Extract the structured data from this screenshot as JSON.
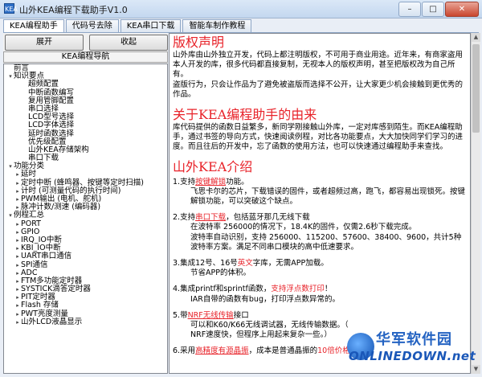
{
  "window": {
    "title": "山外KEA编程下载助手V1.0",
    "icon_text": "KEA",
    "minimize": "–",
    "maximize": "□",
    "close": "✕"
  },
  "tabs": [
    {
      "label": "KEA编程助手",
      "active": true
    },
    {
      "label": "代码号去除",
      "active": false
    },
    {
      "label": "KEA串口下载",
      "active": false
    },
    {
      "label": "智能车制作教程",
      "active": false
    }
  ],
  "left": {
    "expand_label": "展开",
    "collapse_label": "收起",
    "nav_title": "KEA编程导航",
    "tree": [
      {
        "label": "前言",
        "indent": 0,
        "exp": ""
      },
      {
        "label": "知识要点",
        "indent": 0,
        "exp": "▾"
      },
      {
        "label": "超频配置",
        "indent": 2,
        "exp": ""
      },
      {
        "label": "中断函数编写",
        "indent": 2,
        "exp": ""
      },
      {
        "label": "复用管脚配置",
        "indent": 2,
        "exp": ""
      },
      {
        "label": "串口选择",
        "indent": 2,
        "exp": ""
      },
      {
        "label": "LCD型号选择",
        "indent": 2,
        "exp": ""
      },
      {
        "label": "LCD字体选择",
        "indent": 2,
        "exp": ""
      },
      {
        "label": "延时函数选择",
        "indent": 2,
        "exp": ""
      },
      {
        "label": "优先级配置",
        "indent": 2,
        "exp": ""
      },
      {
        "label": "山外KEA存储架构",
        "indent": 2,
        "exp": ""
      },
      {
        "label": "串口下载",
        "indent": 2,
        "exp": ""
      },
      {
        "label": "功能分类",
        "indent": 0,
        "exp": "▾"
      },
      {
        "label": "延时",
        "indent": 1,
        "exp": "▸"
      },
      {
        "label": "定时中断 (蜂鸣器、按键等定时扫描)",
        "indent": 1,
        "exp": "▸"
      },
      {
        "label": "计时 (可测量代码的执行时间)",
        "indent": 1,
        "exp": "▸"
      },
      {
        "label": "PWM输出 (电机、舵机)",
        "indent": 1,
        "exp": "▸"
      },
      {
        "label": "脉冲计数/测速 (编码器)",
        "indent": 1,
        "exp": "▸"
      },
      {
        "label": "例程汇总",
        "indent": 0,
        "exp": "▾"
      },
      {
        "label": "PORT",
        "indent": 1,
        "exp": "▸"
      },
      {
        "label": "GPIO",
        "indent": 1,
        "exp": "▸"
      },
      {
        "label": "IRQ_IO中断",
        "indent": 1,
        "exp": "▸"
      },
      {
        "label": "KBI_IO中断",
        "indent": 1,
        "exp": "▸"
      },
      {
        "label": "UART串口通信",
        "indent": 1,
        "exp": "▸"
      },
      {
        "label": "SPI通信",
        "indent": 1,
        "exp": "▸"
      },
      {
        "label": "ADC",
        "indent": 1,
        "exp": "▸"
      },
      {
        "label": "FTM多功能定时器",
        "indent": 1,
        "exp": "▸"
      },
      {
        "label": "SYSTICK滴答定时器",
        "indent": 1,
        "exp": "▸"
      },
      {
        "label": "PIT定时器",
        "indent": 1,
        "exp": "▸"
      },
      {
        "label": "Flash 存储",
        "indent": 1,
        "exp": "▸"
      },
      {
        "label": "PWT亮度测量",
        "indent": 1,
        "exp": "▸"
      },
      {
        "label": "山外LCD液晶显示",
        "indent": 1,
        "exp": "▸"
      }
    ]
  },
  "content": {
    "h1": "版权声明",
    "p1": "山外库由山外独立开发，代码上都注明版权，不可用于商业用途。近年来，有商家盗用本人开发的库，很多代码都直接复制，无视本人的版权声明，甚至把版权改为自己所有。",
    "p2": "盗版行为，只会让作品为了避免被盗版而选择不公开，让大家更少机会接触到更优秀的作品。",
    "h2": "关于KEA编程助手的由来",
    "p3": "库代码提供的函数日益繁多，新同学刚接触山外库，一定对库感到陌生。而KEA编程助手，通过书签的导向方式，快速阅读例程，对比各功能要点，大大加快同学们学习的进度。而且往后的开发中，忘了函数的使用方法，也可以快速通过编程助手来查找。",
    "h3": "山外KEA介绍",
    "s1_a": "1.支持",
    "s1_b": "按键解锁",
    "s1_c": "功能。",
    "s1_d": "飞思卡尔的芯片，下载错误的固件，或者超频过高，跑飞，都容易出现锁死。按键解锁功能，可以突破这个缺点。",
    "s2_a": "2.支持",
    "s2_b": "串口下载",
    "s2_c": "，包括蓝牙那几无线下载",
    "s2_d": "在波特率 256000的情况下，18.4K的固件，仅需2.6秒下载完成。",
    "s2_e": "波特率自动识别，支持 256000、115200、57600、38400、9600，共计5种波特率方案。满足不同串口模块的高中低速要求。",
    "s3_a": "3.集成12号、16号",
    "s3_b": "英文",
    "s3_c": "字库，无需APP加载。",
    "s3_d": "节省APP的体积。",
    "s4_a": "4.集成printf和sprintf函数，",
    "s4_b": "支持浮点数打印",
    "s4_c": "！",
    "s4_d": "IAR自带的函数有bug，打印浮点数异常的。",
    "s5_a": "5.带",
    "s5_b": "NRF无线传输",
    "s5_c": "接口",
    "s5_d": "可以和K60/K66无线调试器，无线传输数据。（",
    "s5_e": "NRF速度快，但程序上用起来复杂一些。）",
    "s6_a": "6.采用",
    "s6_b": "高精度有源晶振",
    "s6_c": "，成本是普通晶振的",
    "s6_d": "10倍价格"
  },
  "watermark": {
    "cn": "华军软件园",
    "en": "ONLINEDOWN.net"
  }
}
